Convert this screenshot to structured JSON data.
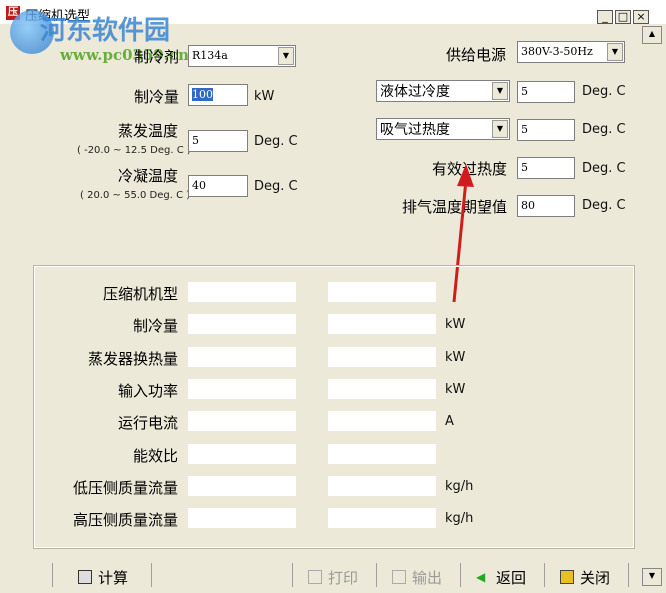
{
  "window": {
    "title": "压缩机选型",
    "logo": "压",
    "minimize": "_",
    "maximize": "□",
    "close": "×"
  },
  "watermark": {
    "brand": "河东软件园",
    "url": "www.pc0359.cn"
  },
  "inputs": {
    "refrigerant": {
      "label": "制冷剂",
      "value": "R134a"
    },
    "capacity": {
      "label": "制冷量",
      "value": "100",
      "unit": "kW"
    },
    "evap_temp": {
      "label": "蒸发温度",
      "range": "( -20.0 ~ 12.5 Deg. C )",
      "value": "5",
      "unit": "Deg. C"
    },
    "cond_temp": {
      "label": "冷凝温度",
      "range": "( 20.0 ~ 55.0 Deg. C )",
      "value": "40",
      "unit": "Deg. C"
    },
    "power_supply": {
      "label": "供给电源",
      "value": "380V-3-50Hz"
    },
    "subcool": {
      "label": "液体过冷度",
      "value": "5",
      "unit": "Deg. C"
    },
    "superheat": {
      "label": "吸气过热度",
      "value": "5",
      "unit": "Deg. C"
    },
    "eff_superheat": {
      "label": "有效过热度",
      "value": "5",
      "unit": "Deg. C"
    },
    "discharge": {
      "label": "排气温度期望值",
      "value": "80",
      "unit": "Deg. C"
    }
  },
  "results": [
    {
      "label": "压缩机机型",
      "unit": ""
    },
    {
      "label": "制冷量",
      "unit": "kW"
    },
    {
      "label": "蒸发器换热量",
      "unit": "kW"
    },
    {
      "label": "输入功率",
      "unit": "kW"
    },
    {
      "label": "运行电流",
      "unit": "A"
    },
    {
      "label": "能效比",
      "unit": ""
    },
    {
      "label": "低压侧质量流量",
      "unit": "kg/h"
    },
    {
      "label": "高压侧质量流量",
      "unit": "kg/h"
    }
  ],
  "toolbar": {
    "calc": "计算",
    "print": "打印",
    "export": "输出",
    "back": "返回",
    "close": "关闭"
  },
  "colors": {
    "accent": "#316ac5",
    "annotation": "#d01c1c"
  }
}
